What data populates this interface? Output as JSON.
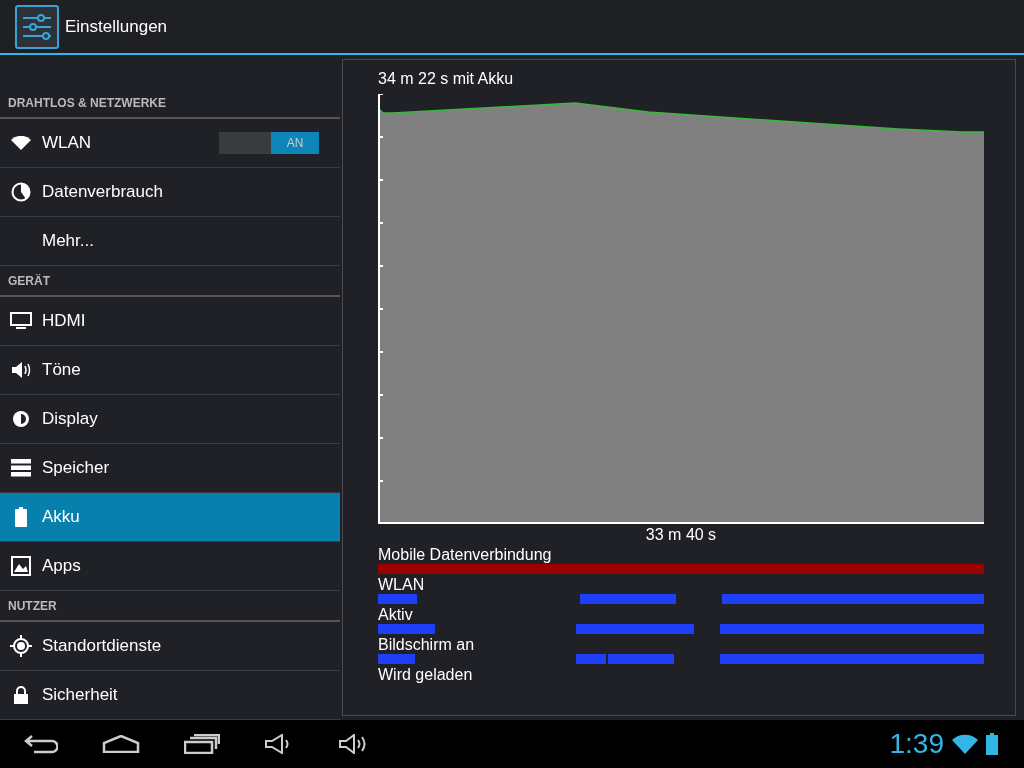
{
  "action_bar": {
    "title": "Einstellungen"
  },
  "sidebar": {
    "sections": [
      {
        "header": "DRAHTLOS & NETZWERKE",
        "items": [
          {
            "label": "WLAN",
            "selected": false,
            "switch": {
              "label": "AN",
              "on": true
            }
          },
          {
            "label": "Datenverbrauch",
            "selected": false
          },
          {
            "label": "Mehr...",
            "selected": false
          }
        ]
      },
      {
        "header": "GERÄT",
        "items": [
          {
            "label": "HDMI",
            "selected": false
          },
          {
            "label": "Töne",
            "selected": false
          },
          {
            "label": "Display",
            "selected": false
          },
          {
            "label": "Speicher",
            "selected": false
          },
          {
            "label": "Akku",
            "selected": true
          },
          {
            "label": "Apps",
            "selected": false
          }
        ]
      },
      {
        "header": "NUTZER",
        "items": [
          {
            "label": "Standortdienste",
            "selected": false
          },
          {
            "label": "Sicherheit",
            "selected": false
          }
        ]
      }
    ]
  },
  "battery_panel": {
    "duration": "34 m 22 s mit Akku",
    "x_axis_label": "33 m 40 s",
    "timeline": [
      {
        "label": "Mobile Datenverbindung"
      },
      {
        "label": "WLAN"
      },
      {
        "label": "Aktiv"
      },
      {
        "label": "Bildschirm an"
      },
      {
        "label": "Wird geladen"
      }
    ]
  },
  "status_bar": {
    "time": "1:39"
  }
}
